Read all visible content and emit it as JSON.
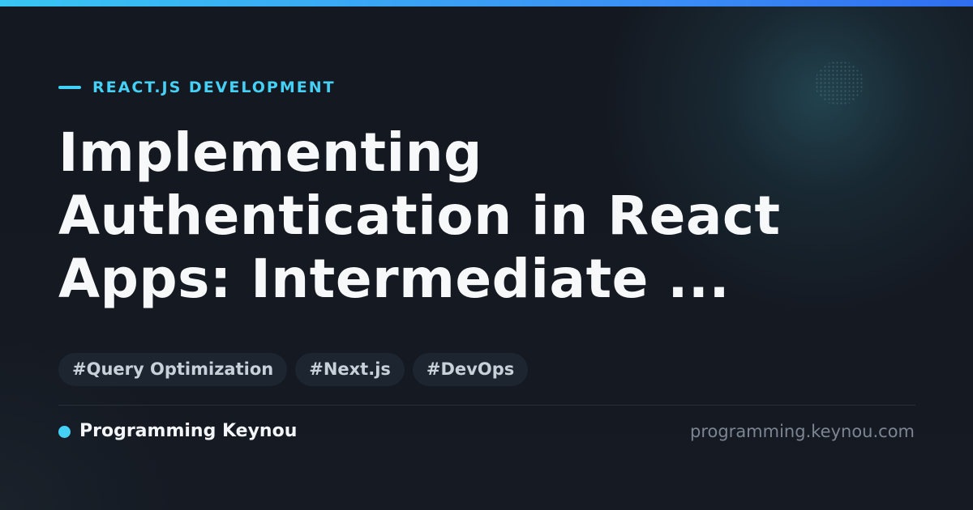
{
  "category": {
    "label": "REACT.JS DEVELOPMENT"
  },
  "title": {
    "text": "Implementing Authentication in React Apps: Intermediate ..."
  },
  "tags": [
    "#Query Optimization",
    "#Next.js",
    "#DevOps"
  ],
  "brand": {
    "name": "Programming Keynou",
    "url": "programming.keynou.com"
  },
  "colors": {
    "accent": "#45d0f6",
    "background": "#141820",
    "gradient_start": "#38c6f2",
    "gradient_end": "#2f6ef0",
    "title": "#f7f8fa",
    "tag_background": "#1d2530"
  }
}
